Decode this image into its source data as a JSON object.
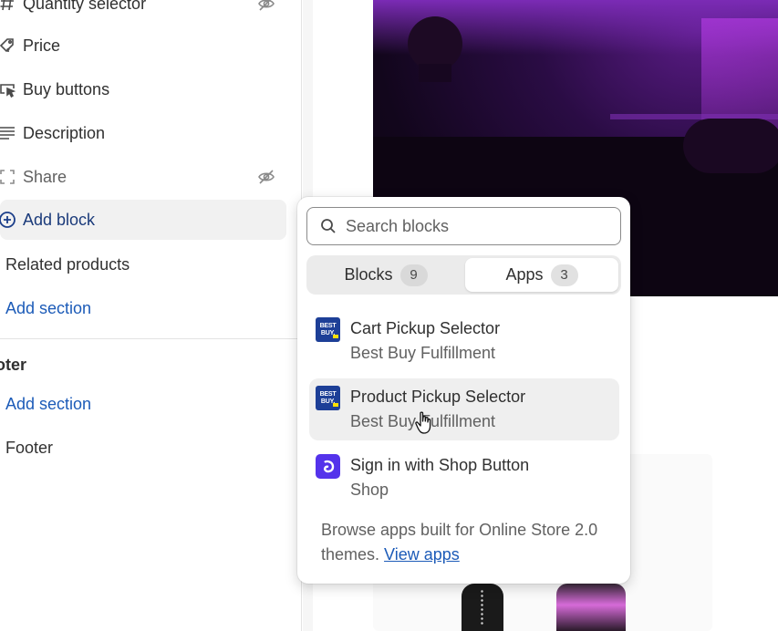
{
  "sidebar": {
    "items": [
      {
        "label": "Quantity selector",
        "icon": "hash-icon",
        "hidden": true
      },
      {
        "label": "Price",
        "icon": "price-tag-icon"
      },
      {
        "label": "Buy buttons",
        "icon": "cursor-button-icon"
      },
      {
        "label": "Description",
        "icon": "text-lines-icon"
      },
      {
        "label": "Share",
        "icon": "share-frame-icon",
        "hidden": true
      },
      {
        "label": "Add block",
        "icon": "plus-circle-icon"
      },
      {
        "label": "Related products"
      },
      {
        "label": "Add section"
      }
    ],
    "footer_group": {
      "heading": "oter",
      "add_section": "Add section",
      "footer": "Footer"
    }
  },
  "popover": {
    "search": {
      "placeholder": "Search blocks"
    },
    "tabs": [
      {
        "label": "Blocks",
        "count": "9"
      },
      {
        "label": "Apps",
        "count": "3",
        "selected": true
      }
    ],
    "apps": [
      {
        "title": "Cart Pickup Selector",
        "provider": "Best Buy Fulfillment",
        "logo": "best-buy-logo"
      },
      {
        "title": "Product Pickup Selector",
        "provider": "Best Buy Fulfillment",
        "logo": "best-buy-logo"
      },
      {
        "title": "Sign in with Shop Button",
        "provider": "Shop",
        "logo": "shop-logo"
      }
    ],
    "footer": {
      "text": "Browse apps built for Online Store 2.0 themes.",
      "link": "View apps"
    }
  },
  "logo_text": {
    "best": "BEST",
    "buy": "BUY."
  },
  "colors": {
    "link": "#1c5bb8",
    "bestbuy_blue": "#1d3f97",
    "bestbuy_yellow": "#ffe000",
    "shop_purple": "#5433eb"
  }
}
